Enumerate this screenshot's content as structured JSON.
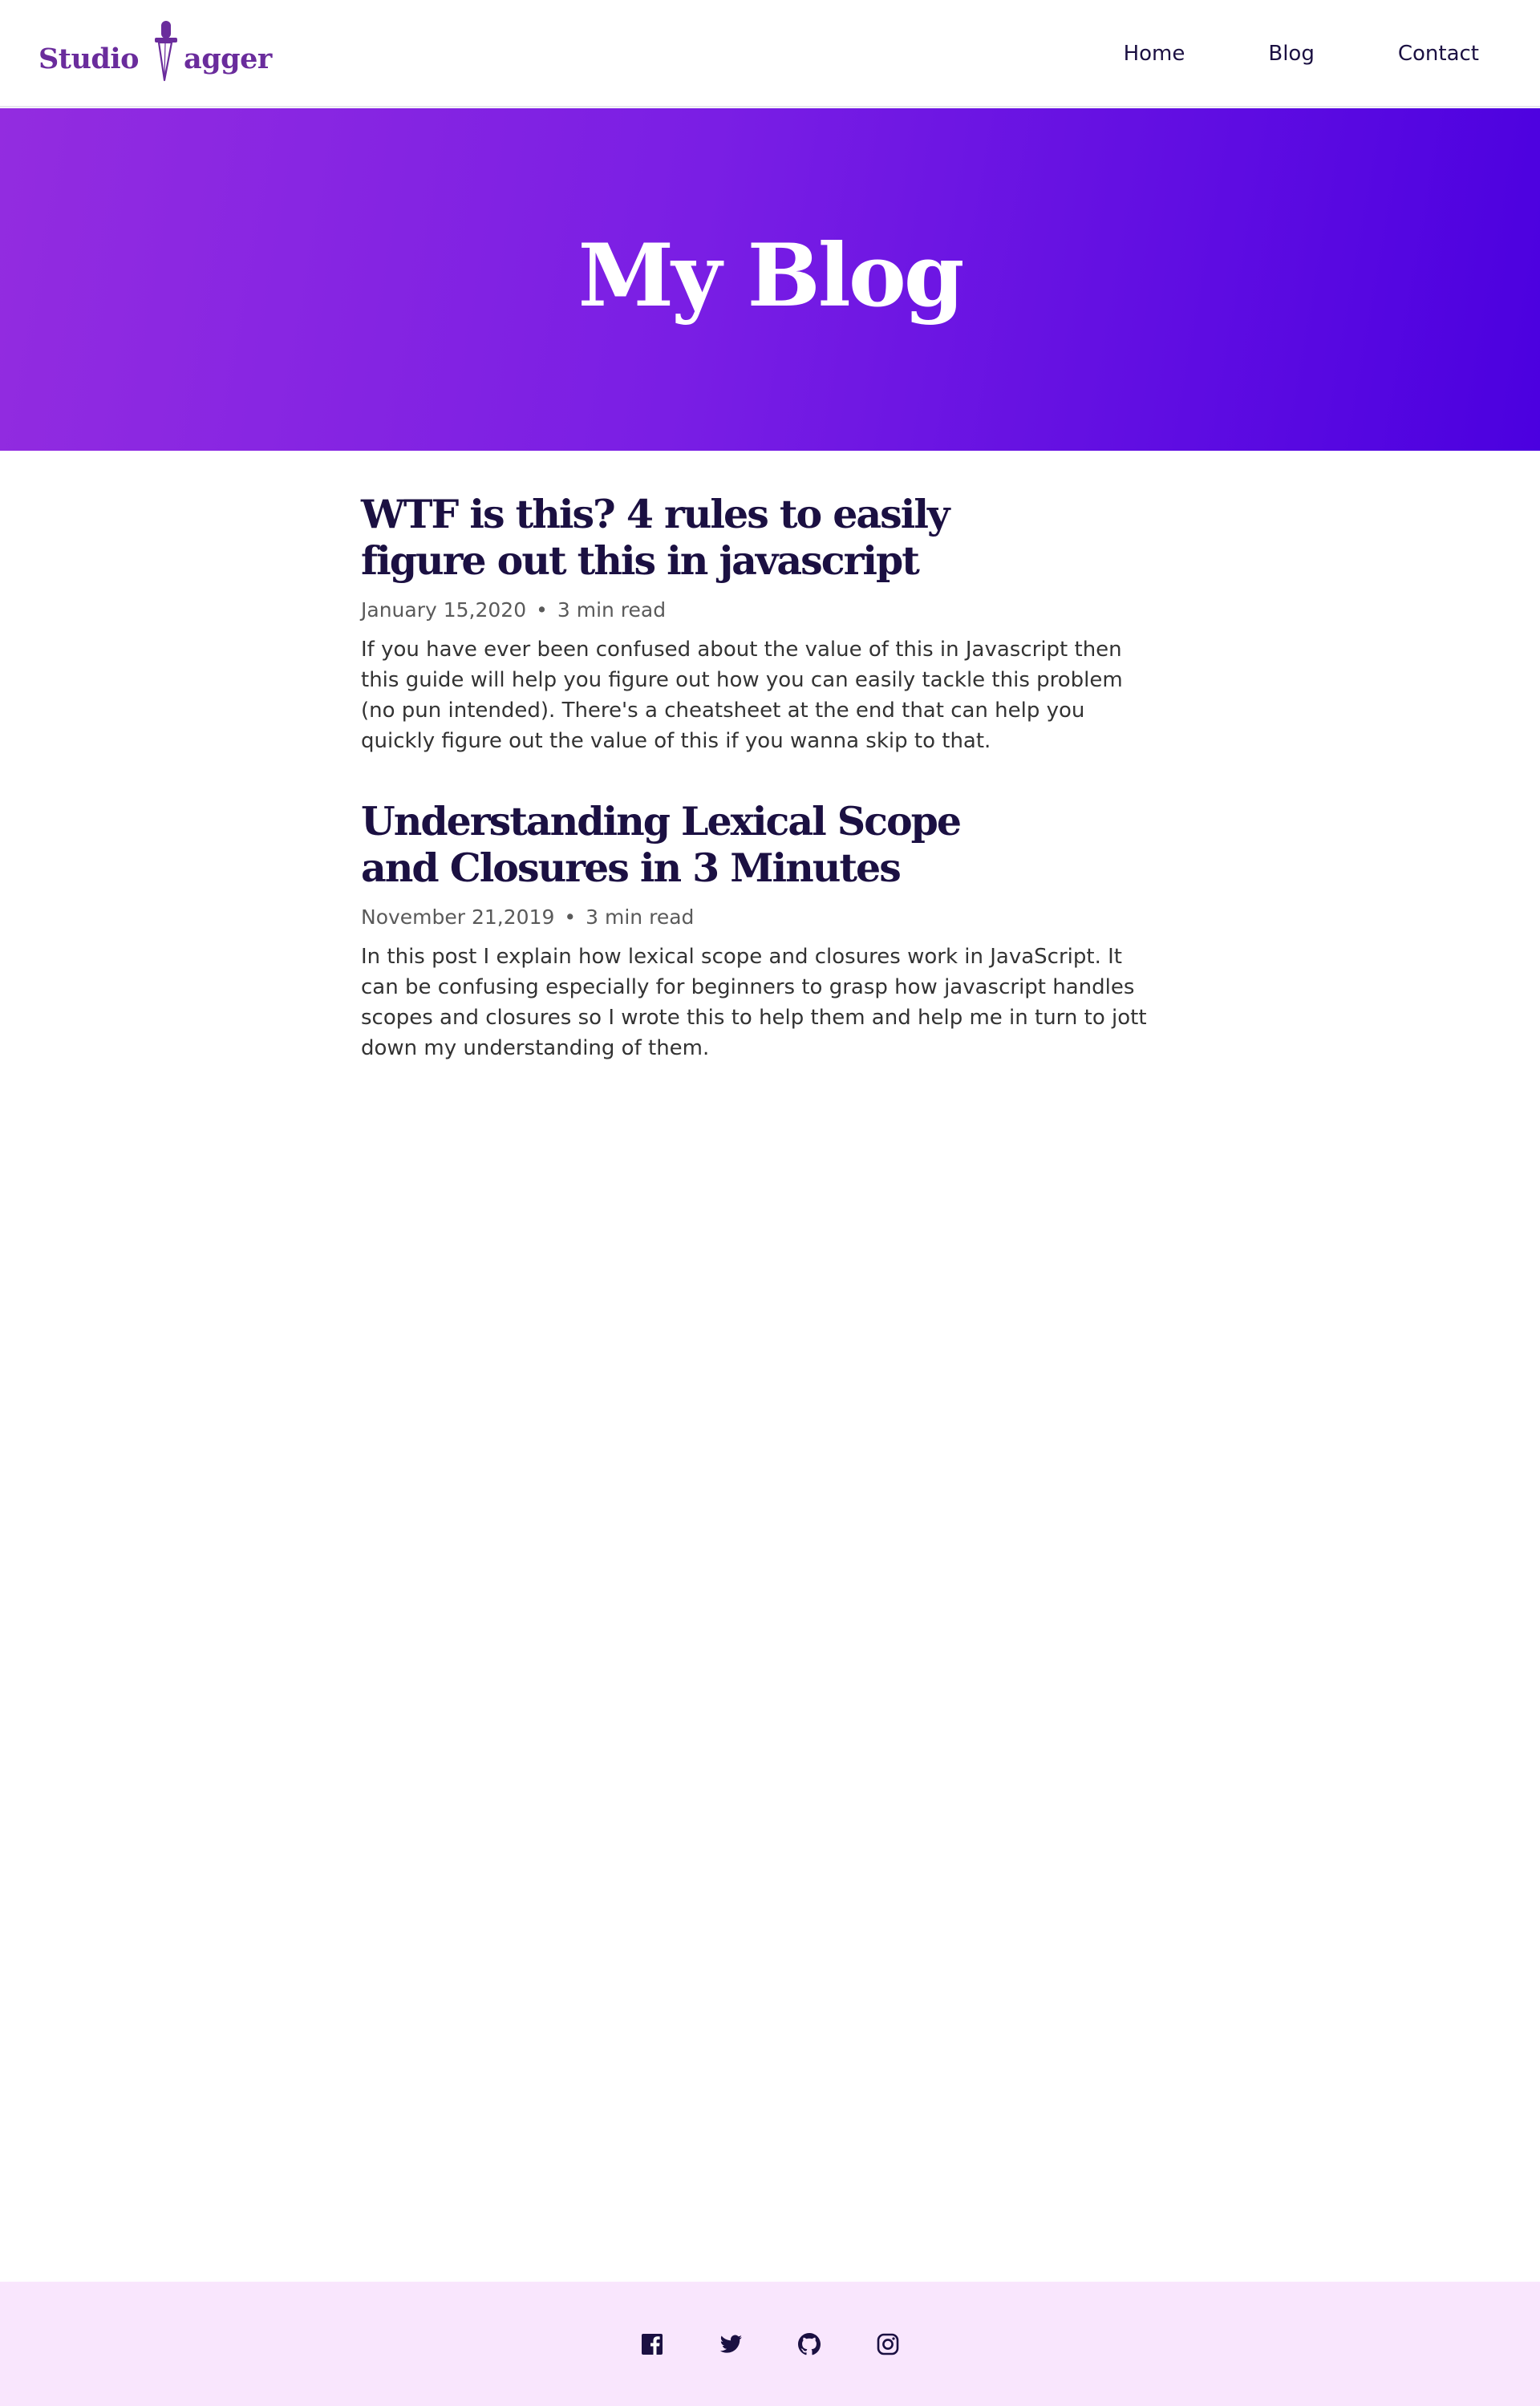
{
  "header": {
    "logo_text_before": "Studio",
    "logo_text_after": "agger",
    "logo_icon": "dagger-icon",
    "nav": [
      {
        "label": "Home"
      },
      {
        "label": "Blog"
      },
      {
        "label": "Contact"
      }
    ]
  },
  "hero": {
    "title": "My Blog"
  },
  "posts": [
    {
      "title": "WTF is this? 4 rules to easily figure out this in javascript",
      "date": "January 15,2020",
      "separator": "•",
      "read_time": "3 min read",
      "excerpt": "If you have ever been confused about the value of this in Javascript then this guide will help you figure out how you can easily tackle this problem (no pun intended). There's a cheatsheet at the end that can help you quickly figure out the value of this if you wanna skip to that."
    },
    {
      "title": "Understanding Lexical Scope and Closures in 3 Minutes",
      "date": "November 21,2019",
      "separator": "•",
      "read_time": "3 min read",
      "excerpt": "In this post I explain how lexical scope and closures work in JavaScript. It can be confusing especially for beginners to grasp how javascript handles scopes and closures so I wrote this to help them and help me in turn to jott down my understanding of them."
    }
  ],
  "footer": {
    "social_icons": [
      "facebook-icon",
      "twitter-icon",
      "github-icon",
      "instagram-icon"
    ]
  },
  "colors": {
    "brand": "#6a2c9c",
    "text_dark": "#1b1042",
    "hero_gradient_start": "#932ce0",
    "hero_gradient_end": "#4b00e0",
    "footer_bg": "#f9e6fd"
  }
}
